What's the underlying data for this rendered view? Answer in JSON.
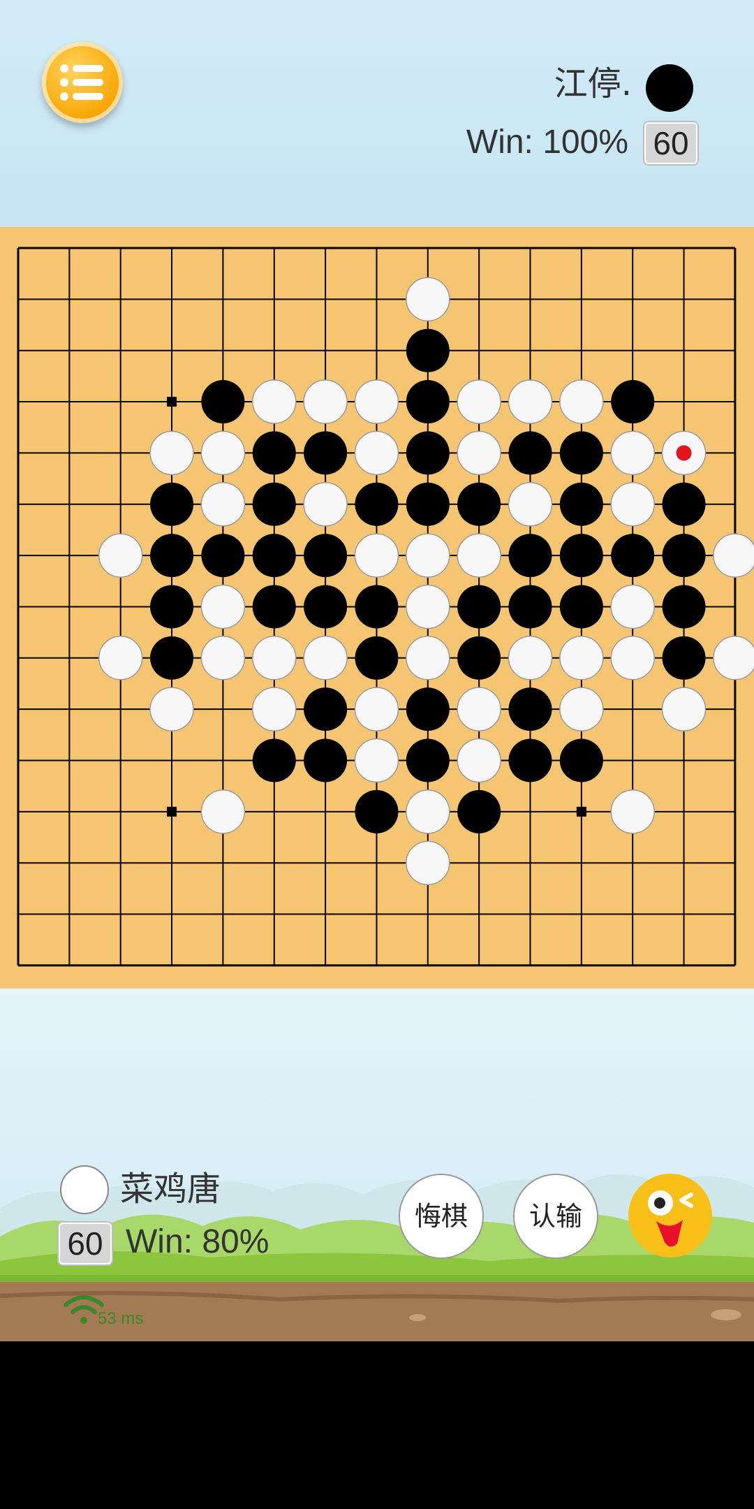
{
  "opponent": {
    "name": "江停.",
    "win_rate": "Win: 100%",
    "timer": "60",
    "stone": "black"
  },
  "player": {
    "name": "菜鸡唐",
    "win_rate": "Win: 80%",
    "timer": "60",
    "stone": "white"
  },
  "buttons": {
    "undo": "悔棋",
    "resign": "认输",
    "menu_icon": "list-icon",
    "emoji_icon": "wink-face-icon"
  },
  "network": {
    "ping": "53 ms",
    "icon": "wifi-icon"
  },
  "board": {
    "size": 15,
    "last_move": {
      "col": 13,
      "row": 4
    },
    "black": [
      [
        8,
        2
      ],
      [
        4,
        3
      ],
      [
        8,
        3
      ],
      [
        12,
        3
      ],
      [
        5,
        4
      ],
      [
        6,
        4
      ],
      [
        8,
        4
      ],
      [
        10,
        4
      ],
      [
        11,
        4
      ],
      [
        3,
        5
      ],
      [
        5,
        5
      ],
      [
        7,
        5
      ],
      [
        8,
        5
      ],
      [
        9,
        5
      ],
      [
        11,
        5
      ],
      [
        13,
        5
      ],
      [
        3,
        6
      ],
      [
        4,
        6
      ],
      [
        5,
        6
      ],
      [
        6,
        6
      ],
      [
        10,
        6
      ],
      [
        11,
        6
      ],
      [
        12,
        6
      ],
      [
        13,
        6
      ],
      [
        3,
        7
      ],
      [
        5,
        7
      ],
      [
        6,
        7
      ],
      [
        7,
        7
      ],
      [
        9,
        7
      ],
      [
        10,
        7
      ],
      [
        11,
        7
      ],
      [
        13,
        7
      ],
      [
        3,
        8
      ],
      [
        7,
        8
      ],
      [
        9,
        8
      ],
      [
        13,
        8
      ],
      [
        6,
        9
      ],
      [
        8,
        9
      ],
      [
        10,
        9
      ],
      [
        5,
        10
      ],
      [
        6,
        10
      ],
      [
        8,
        10
      ],
      [
        10,
        10
      ],
      [
        11,
        10
      ],
      [
        7,
        11
      ],
      [
        9,
        11
      ]
    ],
    "white": [
      [
        8,
        1
      ],
      [
        5,
        3
      ],
      [
        6,
        3
      ],
      [
        7,
        3
      ],
      [
        9,
        3
      ],
      [
        10,
        3
      ],
      [
        11,
        3
      ],
      [
        3,
        4
      ],
      [
        4,
        4
      ],
      [
        7,
        4
      ],
      [
        9,
        4
      ],
      [
        12,
        4
      ],
      [
        13,
        4
      ],
      [
        4,
        5
      ],
      [
        6,
        5
      ],
      [
        10,
        5
      ],
      [
        12,
        5
      ],
      [
        2,
        6
      ],
      [
        7,
        6
      ],
      [
        8,
        6
      ],
      [
        9,
        6
      ],
      [
        14,
        6
      ],
      [
        4,
        7
      ],
      [
        8,
        7
      ],
      [
        12,
        7
      ],
      [
        2,
        8
      ],
      [
        4,
        8
      ],
      [
        5,
        8
      ],
      [
        6,
        8
      ],
      [
        8,
        8
      ],
      [
        10,
        8
      ],
      [
        11,
        8
      ],
      [
        12,
        8
      ],
      [
        14,
        8
      ],
      [
        3,
        9
      ],
      [
        5,
        9
      ],
      [
        7,
        9
      ],
      [
        9,
        9
      ],
      [
        11,
        9
      ],
      [
        13,
        9
      ],
      [
        7,
        10
      ],
      [
        9,
        10
      ],
      [
        4,
        11
      ],
      [
        8,
        11
      ],
      [
        12,
        11
      ],
      [
        8,
        12
      ]
    ],
    "stars": [
      [
        3,
        3
      ],
      [
        3,
        11
      ],
      [
        11,
        11
      ]
    ]
  },
  "colors": {
    "board": "#f5c572",
    "menu": "#f7a500",
    "emoji": "#f8bf18"
  }
}
